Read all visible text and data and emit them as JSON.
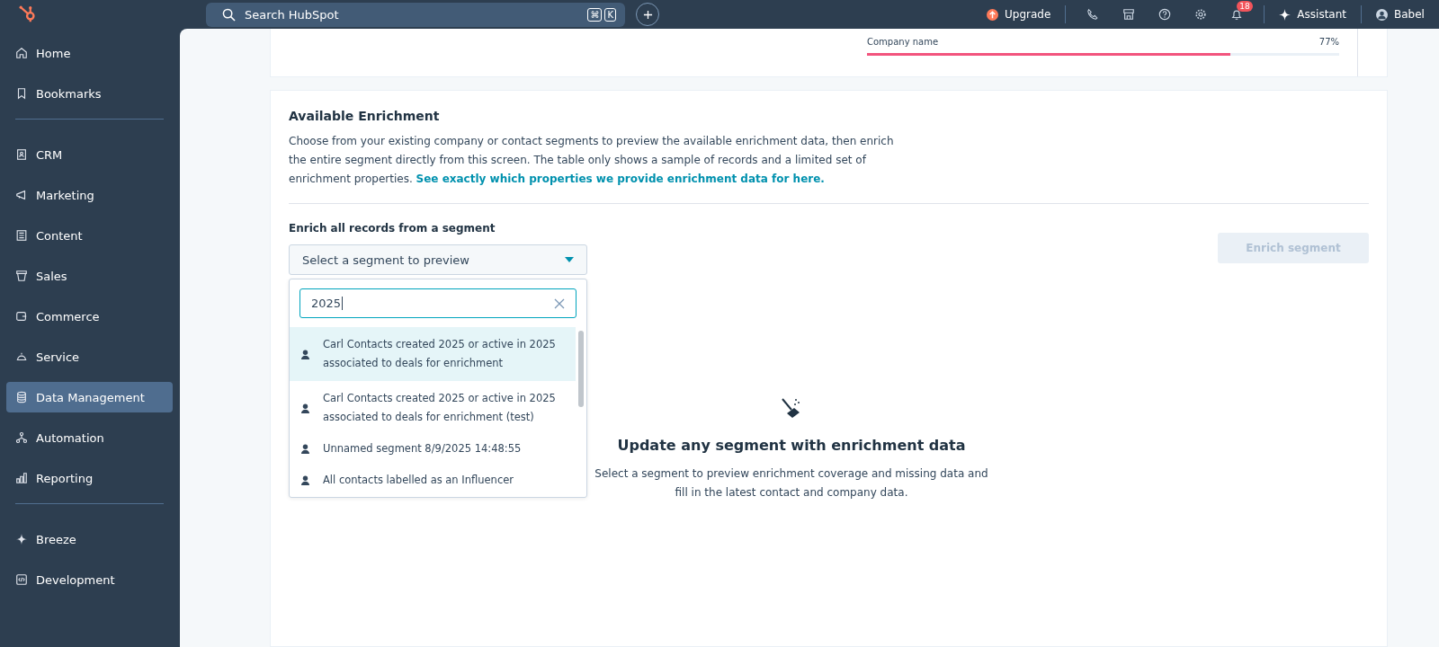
{
  "topbar": {
    "search_placeholder": "Search HubSpot",
    "shortcut_keys": [
      "⌘",
      "K"
    ],
    "upgrade": "Upgrade",
    "notifications_count": "18",
    "assistant": "Assistant",
    "account": "Babel"
  },
  "sidebar": {
    "groups": [
      [
        {
          "label": "Home",
          "selected": false
        },
        {
          "label": "Bookmarks",
          "selected": false
        }
      ],
      [
        {
          "label": "CRM",
          "selected": false
        },
        {
          "label": "Marketing",
          "selected": false
        },
        {
          "label": "Content",
          "selected": false
        },
        {
          "label": "Sales",
          "selected": false
        },
        {
          "label": "Commerce",
          "selected": false
        },
        {
          "label": "Service",
          "selected": false
        },
        {
          "label": "Data Management",
          "selected": true
        },
        {
          "label": "Automation",
          "selected": false
        },
        {
          "label": "Reporting",
          "selected": false
        }
      ],
      [
        {
          "label": "Breeze",
          "selected": false
        },
        {
          "label": "Development",
          "selected": false
        }
      ]
    ]
  },
  "coverage": {
    "label": "Company name",
    "reading": "77%",
    "level": 0.77
  },
  "enrichment": {
    "title": "Available Enrichment",
    "description": "Choose from your existing company or contact segments to preview the available enrichment data, then enrich the entire segment directly from this screen. The table only shows a sample of records and a limited set of enrichment properties.",
    "link": "See exactly which properties we provide enrichment data for here.",
    "segment_label": "Enrich all records from a segment",
    "dropdown_placeholder": "Select a segment to preview",
    "enrich_button": {
      "label": "Enrich segment",
      "disabled": true
    },
    "search_value": "2025",
    "options": [
      {
        "label": "Carl Contacts created 2025 or active in 2025 associated to deals for enrichment",
        "selected": true
      },
      {
        "label": "Carl Contacts created 2025 or active in 2025 associated to deals for enrichment (test)",
        "selected": false
      },
      {
        "label": "Unnamed segment 8/9/2025 14:48:55",
        "selected": false
      },
      {
        "label": "All contacts labelled as an Influencer",
        "selected": false
      }
    ],
    "empty_title": "Update any segment with enrichment data",
    "empty_text": "Select a segment to preview enrichment coverage and missing data and fill in the latest contact and company data."
  }
}
